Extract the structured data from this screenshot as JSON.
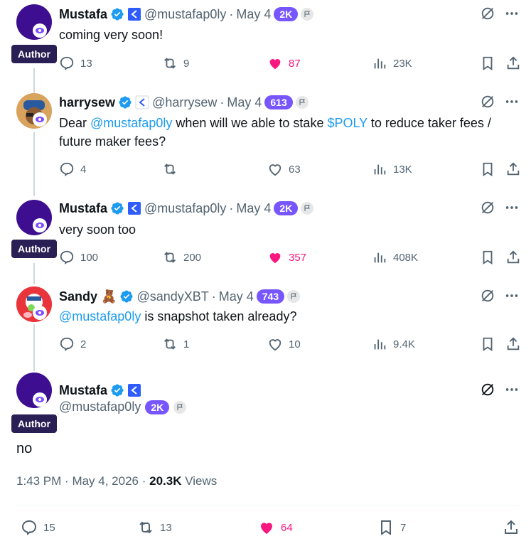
{
  "colors": {
    "accent": "#1d9bf0",
    "like": "#f91880",
    "score": "#7856ff",
    "author_tag": "#2a1f54"
  },
  "author_label": "Author",
  "tweets": [
    {
      "name": "Mustafa",
      "handle": "@mustafap0ly",
      "date": "May 4",
      "score": "2K",
      "text": "coming very soon!",
      "replies": "13",
      "reposts": "9",
      "likes": "87",
      "views": "23K"
    },
    {
      "name": "harrysew",
      "handle": "@harrysew",
      "date": "May 4",
      "score": "613",
      "text_parts": [
        "Dear ",
        "@mustafap0ly",
        " when will we able to stake ",
        "$POLY",
        " to reduce taker fees / future maker fees?"
      ],
      "replies": "4",
      "reposts": "",
      "likes": "63",
      "views": "13K"
    },
    {
      "name": "Mustafa",
      "handle": "@mustafap0ly",
      "date": "May 4",
      "score": "2K",
      "text": "very soon too",
      "replies": "100",
      "reposts": "200",
      "likes": "357",
      "views": "408K"
    },
    {
      "name": "Sandy 🧸",
      "handle": "@sandyXBT",
      "date": "May 4",
      "score": "743",
      "text_parts": [
        "@mustafap0ly",
        " is snapshot taken already?"
      ],
      "replies": "2",
      "reposts": "1",
      "likes": "10",
      "views": "9.4K"
    }
  ],
  "main_tweet": {
    "name": "Mustafa",
    "handle": "@mustafap0ly",
    "score": "2K",
    "text": "no",
    "time": "1:43 PM",
    "date": "May 4, 2026",
    "views_count": "20.3K",
    "views_label": "Views",
    "replies": "15",
    "reposts": "13",
    "likes": "64",
    "bookmarks": "7"
  }
}
